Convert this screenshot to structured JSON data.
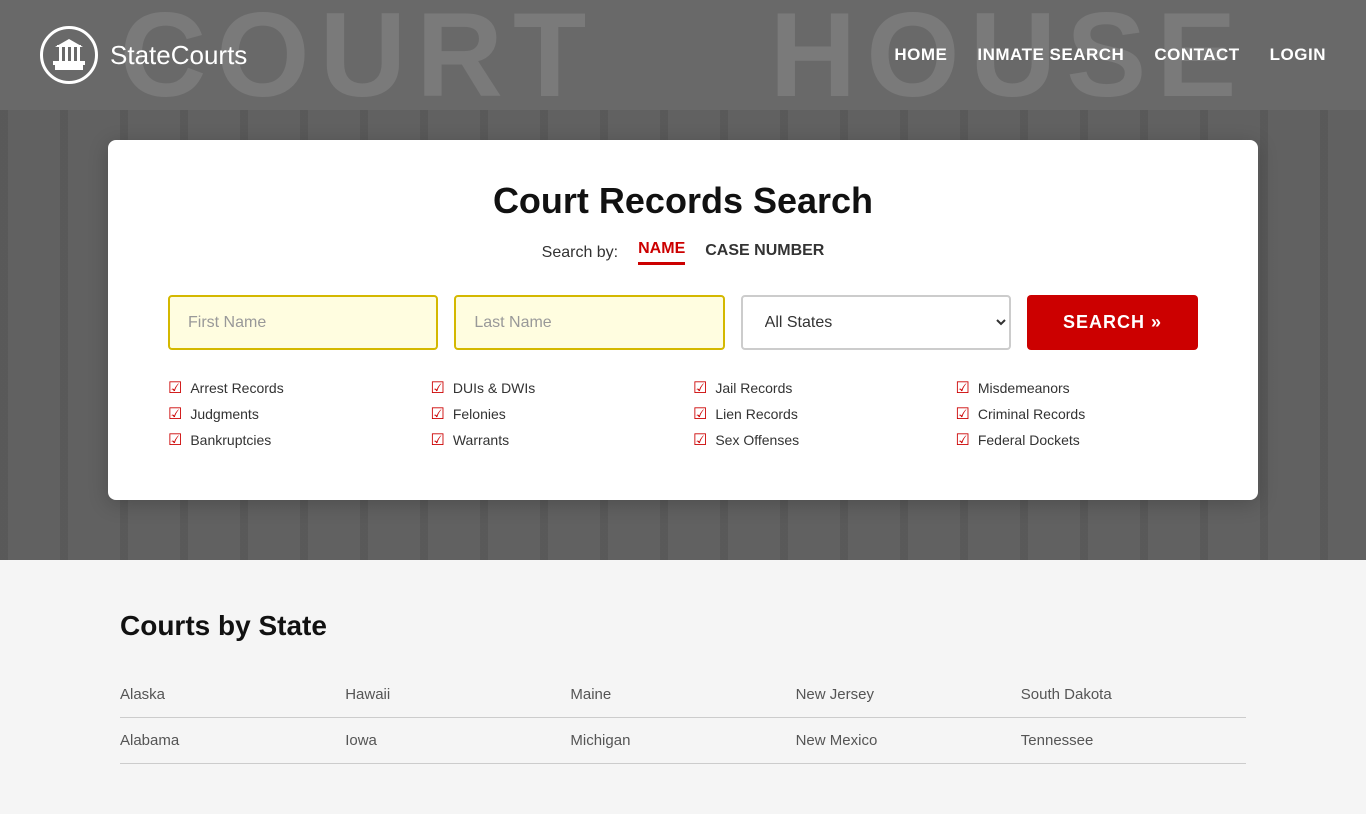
{
  "header": {
    "logo_text_bold": "State",
    "logo_text_light": "Courts",
    "bg_letters": "COURT   HOUSE",
    "nav": [
      {
        "label": "HOME",
        "id": "home"
      },
      {
        "label": "INMATE SEARCH",
        "id": "inmate-search"
      },
      {
        "label": "CONTACT",
        "id": "contact"
      },
      {
        "label": "LOGIN",
        "id": "login"
      }
    ]
  },
  "search": {
    "title": "Court Records Search",
    "search_by_label": "Search by:",
    "tab_name": "NAME",
    "tab_case_number": "CASE NUMBER",
    "first_name_placeholder": "First Name",
    "last_name_placeholder": "Last Name",
    "state_default": "All States",
    "search_button": "SEARCH »",
    "checkboxes": [
      "Arrest Records",
      "Judgments",
      "Bankruptcies",
      "DUIs & DWIs",
      "Felonies",
      "Warrants",
      "Jail Records",
      "Lien Records",
      "Sex Offenses",
      "Misdemeanors",
      "Criminal Records",
      "Federal Dockets"
    ]
  },
  "courts_section": {
    "title": "Courts by State",
    "states": [
      [
        "Alaska",
        "Alabama"
      ],
      [
        "Hawaii",
        "Iowa"
      ],
      [
        "Maine",
        "Michigan"
      ],
      [
        "New Jersey",
        "New Mexico"
      ],
      [
        "South Dakota",
        "Tennessee"
      ]
    ]
  }
}
